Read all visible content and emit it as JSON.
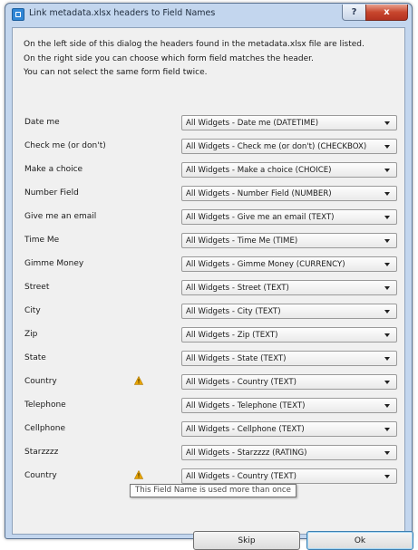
{
  "window": {
    "title": "Link metadata.xlsx headers to Field Names",
    "help_glyph": "?",
    "close_glyph": "x"
  },
  "intro": {
    "line1": "On the left side of this dialog the headers found in the metadata.xlsx file are listed.",
    "line2": "On the right side you can choose which form field matches the header.",
    "line3": "You can not select the same form field twice."
  },
  "rows": [
    {
      "label": "Date me",
      "selected": "All Widgets - Date me (DATETIME)",
      "warning": false
    },
    {
      "label": "Check me (or don't)",
      "selected": "All Widgets - Check me (or don't) (CHECKBOX)",
      "warning": false
    },
    {
      "label": "Make a choice",
      "selected": "All Widgets - Make a choice (CHOICE)",
      "warning": false
    },
    {
      "label": "Number Field",
      "selected": "All Widgets - Number Field (NUMBER)",
      "warning": false
    },
    {
      "label": "Give me an email",
      "selected": "All Widgets - Give me an email (TEXT)",
      "warning": false
    },
    {
      "label": "Time Me",
      "selected": "All Widgets - Time Me (TIME)",
      "warning": false
    },
    {
      "label": "Gimme Money",
      "selected": "All Widgets - Gimme Money (CURRENCY)",
      "warning": false
    },
    {
      "label": "Street",
      "selected": "All Widgets - Street (TEXT)",
      "warning": false
    },
    {
      "label": "City",
      "selected": "All Widgets - City (TEXT)",
      "warning": false
    },
    {
      "label": "Zip",
      "selected": "All Widgets - Zip (TEXT)",
      "warning": false
    },
    {
      "label": "State",
      "selected": "All Widgets - State (TEXT)",
      "warning": false
    },
    {
      "label": "Country",
      "selected": "All Widgets - Country (TEXT)",
      "warning": true
    },
    {
      "label": "Telephone",
      "selected": "All Widgets - Telephone (TEXT)",
      "warning": false
    },
    {
      "label": "Cellphone",
      "selected": "All Widgets - Cellphone (TEXT)",
      "warning": false
    },
    {
      "label": "Starzzzz",
      "selected": "All Widgets - Starzzzz (RATING)",
      "warning": false
    },
    {
      "label": "Country",
      "selected": "All Widgets - Country (TEXT)",
      "warning": true
    }
  ],
  "tooltip": "This Field Name is used more than once",
  "buttons": {
    "skip": "Skip",
    "ok": "Ok"
  },
  "icons": {
    "app": "dialog-app-icon",
    "warning": "warning-triangle-icon",
    "dropdown": "chevron-down-icon"
  },
  "colors": {
    "warning": "#e8a400",
    "close_button": "#c8462d",
    "window_frame": "#c3d6ee"
  }
}
